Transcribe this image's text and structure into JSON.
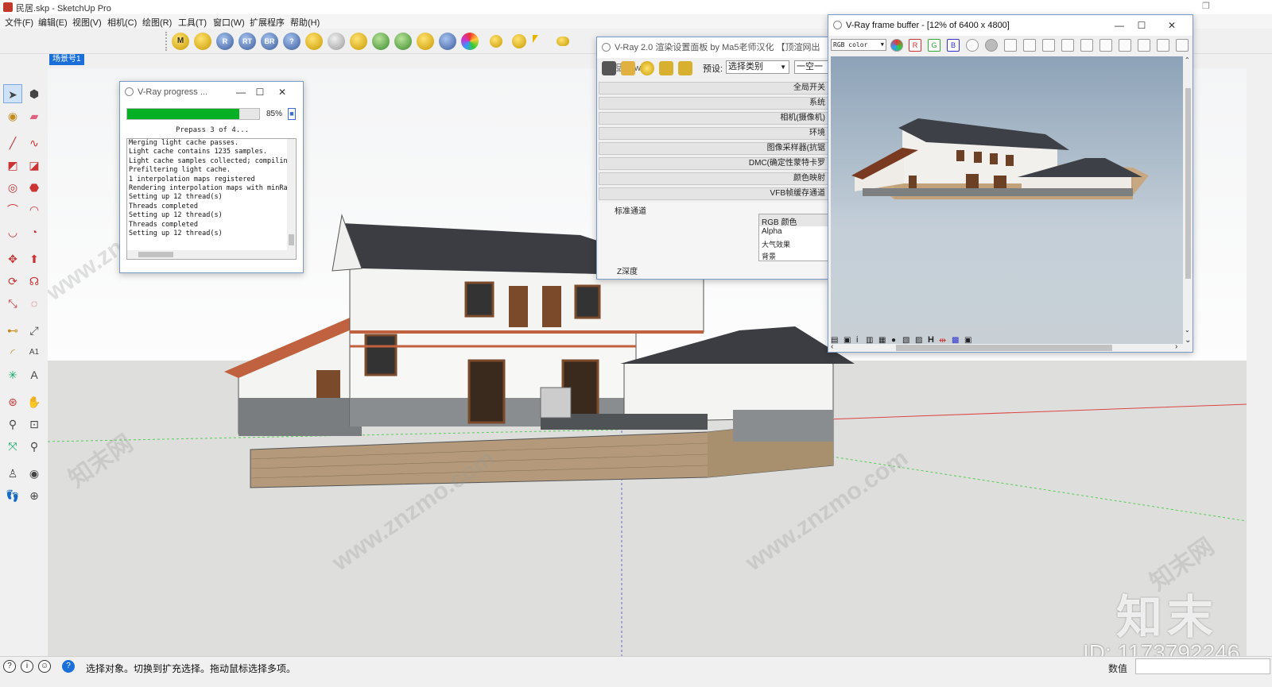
{
  "window": {
    "title": "民居.skp - SketchUp Pro",
    "restore_glyph": "❐"
  },
  "menu": [
    "文件(F)",
    "编辑(E)",
    "视图(V)",
    "相机(C)",
    "绘图(R)",
    "工具(T)",
    "窗口(W)",
    "扩展程序",
    "帮助(H)"
  ],
  "toolbar": {
    "buttons": [
      "M",
      "",
      "R",
      "RT",
      "BR",
      "?",
      "",
      "",
      "",
      "",
      "",
      "",
      "",
      "",
      "",
      ""
    ]
  },
  "scene_tab": "场景号1",
  "progress_dialog": {
    "title": "V-Ray progress ...",
    "percent_value": 85,
    "percent_label": "85%",
    "status": "Prepass 3 of 4...",
    "log": [
      "Merging light cache passes.",
      "Light cache contains 1235 samples.",
      "Light cache samples collected; compilin",
      "Prefiltering light cache.",
      "1 interpolation maps registered",
      "Rendering interpolation maps with minRa",
      "Setting up 12 thread(s)",
      "Threads completed",
      "Setting up 12 thread(s)",
      "Threads completed",
      "Setting up 12 thread(s)"
    ]
  },
  "settings_dialog": {
    "title": "V-Ray 2.0 渲染设置面板 by Ma5老师汉化 【顶渲网出品】 w",
    "preset_label": "预设:",
    "preset_value": "选择类别",
    "preset_value2": "一空一",
    "rollouts": [
      "全局开关",
      "系统",
      "相机(摄像机)",
      "环境",
      "图像采样器(抗锯",
      "DMC(确定性蒙特卡罗",
      "颜色映射",
      "VFB帧缓存通道"
    ],
    "channels_group": "标准通道",
    "channels": [
      "RGB 颜色",
      "Alpha",
      "大气效果",
      "背景"
    ],
    "zdepth_label": "Z深度"
  },
  "frame_buffer": {
    "title": "V-Ray frame buffer - [12% of 6400 x 4800]",
    "channel": "RGB color",
    "rgb_buttons": [
      "R",
      "G",
      "B"
    ]
  },
  "status": {
    "message": "选择对象。切换到扩充选择。拖动鼠标选择多项。",
    "value_label": "数值"
  },
  "watermark": {
    "brand": "知末",
    "id": "ID: 1173792246",
    "site": "www.znzmo.com",
    "site_cn": "知末网"
  },
  "colors": {
    "accent": "#1a70d8",
    "progress": "#06b025",
    "sky": "#f4f5f6",
    "ground": "#dedfdc"
  }
}
